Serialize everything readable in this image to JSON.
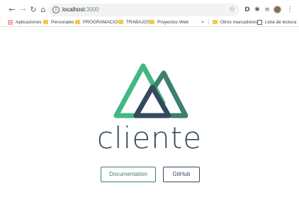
{
  "browser": {
    "url_host": "localhost",
    "url_port": ":3000"
  },
  "bookmarks": [
    {
      "label": "Aplicaciones",
      "icon": "apps-grid-icon"
    },
    {
      "label": "Personales",
      "icon": "folder-icon"
    },
    {
      "label": "PROGRAMACION",
      "icon": "folder-icon"
    },
    {
      "label": "TRABAJOS",
      "icon": "folder-icon"
    },
    {
      "label": "Proyectos Web",
      "icon": "folder-icon"
    },
    {
      "label": "Otros marcadores",
      "icon": "folder-icon"
    },
    {
      "label": "Lista de lectura",
      "icon": "reading-list-icon"
    }
  ],
  "page": {
    "app_title": "cliente",
    "buttons": {
      "documentation": "Documentation",
      "github": "GitHub"
    }
  },
  "colors": {
    "logo_green": "#41b883",
    "logo_dark_green": "#3b8070",
    "logo_navy": "#35495e",
    "title": "#35495e"
  }
}
